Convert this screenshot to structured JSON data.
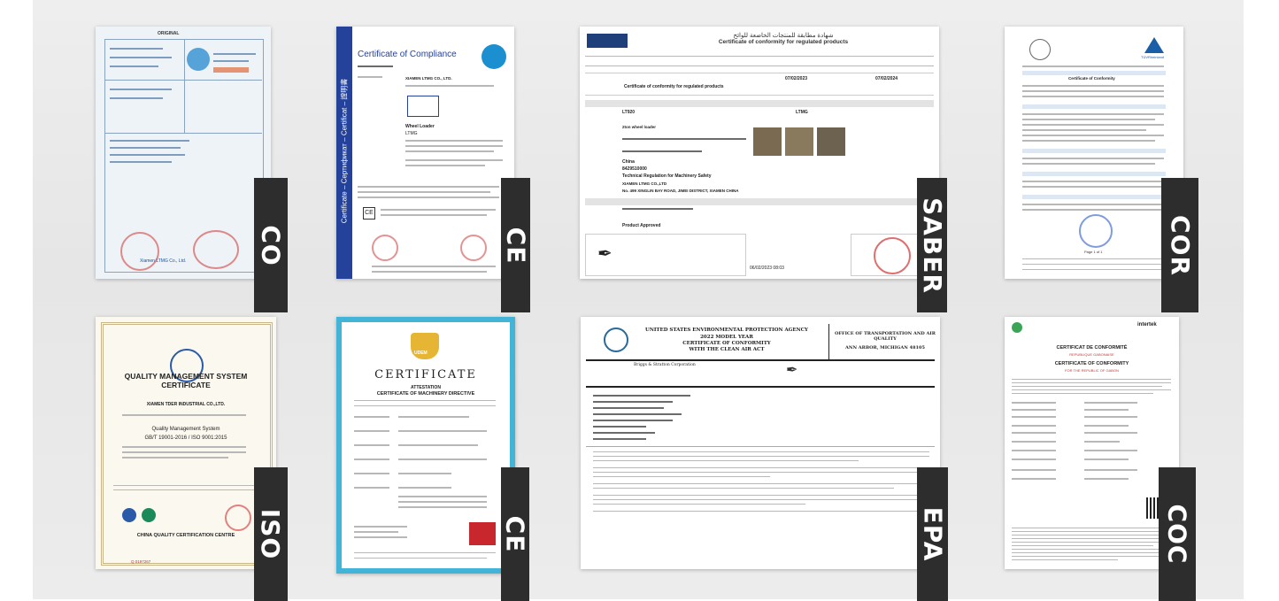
{
  "certificates": [
    {
      "id": "co",
      "label": "CO",
      "title": "ORIGINAL",
      "issuer": "Xiamen LTMG Co., Ltd."
    },
    {
      "id": "ce1",
      "label": "CE",
      "title": "Certificate of Compliance",
      "holder": "XIAMEN LTMG CO., LTD.",
      "product": "Wheel Loader",
      "brand": "LTMG",
      "side_text": "Certificate – Сертификат – Certificat – 證明書"
    },
    {
      "id": "saber",
      "label": "SABER",
      "title": "Certificate of conformity for regulated products",
      "arabic_title": "شهادة مطابقة للمنتجات الخاضعة للوائح",
      "cert_type": "Certificate of conformity for regulated products",
      "product": "2ton wheel loader",
      "brand": "LTMG",
      "model": "LT920",
      "country": "China",
      "hs": "8429510000",
      "regulation": "Technical Regulation for Machinery Safety",
      "maker": "XIAMEN LTMG CO.,LTD",
      "address": "No. 499 XINGLIN BAY ROAD, JIMEI DISTRICT, XIAMEN CHINA",
      "status": "Product Approved",
      "date_issued": "07/02/2023",
      "date_expiry": "07/02/2024",
      "stamp_time": "06/02/2023 08:03"
    },
    {
      "id": "cor",
      "label": "COR",
      "title": "Certificate of Conformity",
      "issuer": "TÜVRheinland",
      "page": "Page 1 of 1"
    },
    {
      "id": "iso",
      "label": "ISO",
      "title": "QUALITY MANAGEMENT SYSTEM CERTIFICATE",
      "company": "XIAMEN TDER INDUSTRIAL CO.,LTD.",
      "system": "Quality Management System",
      "standard": "GB/T 19001-2016 / ISO 9001:2015",
      "centre": "CHINA QUALITY CERTIFICATION CENTRE",
      "number": "Q 0197267"
    },
    {
      "id": "ce2",
      "label": "CE",
      "title": "CERTIFICATE",
      "subtitle": "ATTESTATION",
      "directive": "CERTIFICATE OF MACHINERY DIRECTIVE",
      "brand": "UDEM"
    },
    {
      "id": "epa",
      "label": "EPA",
      "title": "UNITED STATES ENVIRONMENTAL PROTECTION AGENCY",
      "year": "2022 MODEL YEAR",
      "cert": "CERTIFICATE OF CONFORMITY",
      "act": "WITH THE CLEAN AIR ACT",
      "office": "OFFICE OF TRANSPORTATION AND AIR QUALITY",
      "city": "ANN ARBOR, MICHIGAN 48105",
      "issued_to": "Briggs & Stratton Corporation"
    },
    {
      "id": "coc",
      "label": "COC",
      "title": "CERTIFICAT DE CONFORMITÉ",
      "subtitle_fr": "REPUBLIQUE GABONAISE",
      "title_en": "CERTIFICATE OF CONFORMITY",
      "subtitle_en": "FOR THE REPUBLIC OF GABON",
      "issuer": "intertek"
    }
  ]
}
